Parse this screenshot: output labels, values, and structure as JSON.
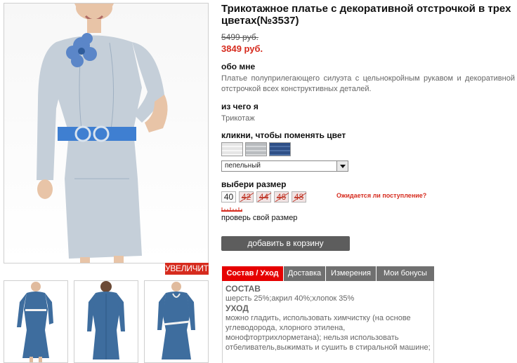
{
  "product": {
    "title": "Трикотажное платье с декоративной отстрочкой в трех цветах(№3537)",
    "old_price": "5499 руб.",
    "new_price": "3849 руб."
  },
  "gallery": {
    "zoom_label": "УВЕЛИЧИТЬ",
    "main_color": "#c5cfd9",
    "thumb_color": "#3e6d9e"
  },
  "about": {
    "heading": "обо мне",
    "text": "Платье полуприлегающего силуэта с цельнокройным рукавом и декоративной отстрочкой всех конструктивных деталей."
  },
  "material": {
    "heading": "из чего я",
    "text": "Трикотаж"
  },
  "color": {
    "heading": "кликни, чтобы поменять цвет",
    "swatches": [
      "light-gray",
      "gray",
      "blue"
    ],
    "selected": "пепельный"
  },
  "size": {
    "heading": "выбери размер",
    "options": [
      {
        "label": "40",
        "available": true
      },
      {
        "label": "42",
        "available": false
      },
      {
        "label": "44",
        "available": false
      },
      {
        "label": "46",
        "available": false
      },
      {
        "label": "48",
        "available": false
      }
    ],
    "waitlist_link": "Ожидается ли поступление?",
    "check_link": "проверь свой размер"
  },
  "cart": {
    "add_label": "добавить в корзину"
  },
  "tabs": {
    "items": [
      {
        "label": "Состав / Уход",
        "active": true
      },
      {
        "label": "Доставка",
        "active": false
      },
      {
        "label": "Измерения",
        "active": false
      },
      {
        "label": "Мои бонусы",
        "active": false
      }
    ],
    "panel": {
      "composition_heading": "СОСТАВ",
      "composition_text": "шерсть 25%;акрил 40%;хлопок 35%",
      "care_heading": "УХОД",
      "care_text": "можно гладить, использовать химчистку (на основе углеводорода, хлорного этилена, монофтортрихлорметана); нельзя использовать отбеливатель,выжимать и сушить в стиральной машине;"
    }
  },
  "colors": {
    "accent_red": "#e60000",
    "price_red": "#d62b1e",
    "button_gray": "#5d5d5d",
    "tab_gray": "#707070"
  }
}
